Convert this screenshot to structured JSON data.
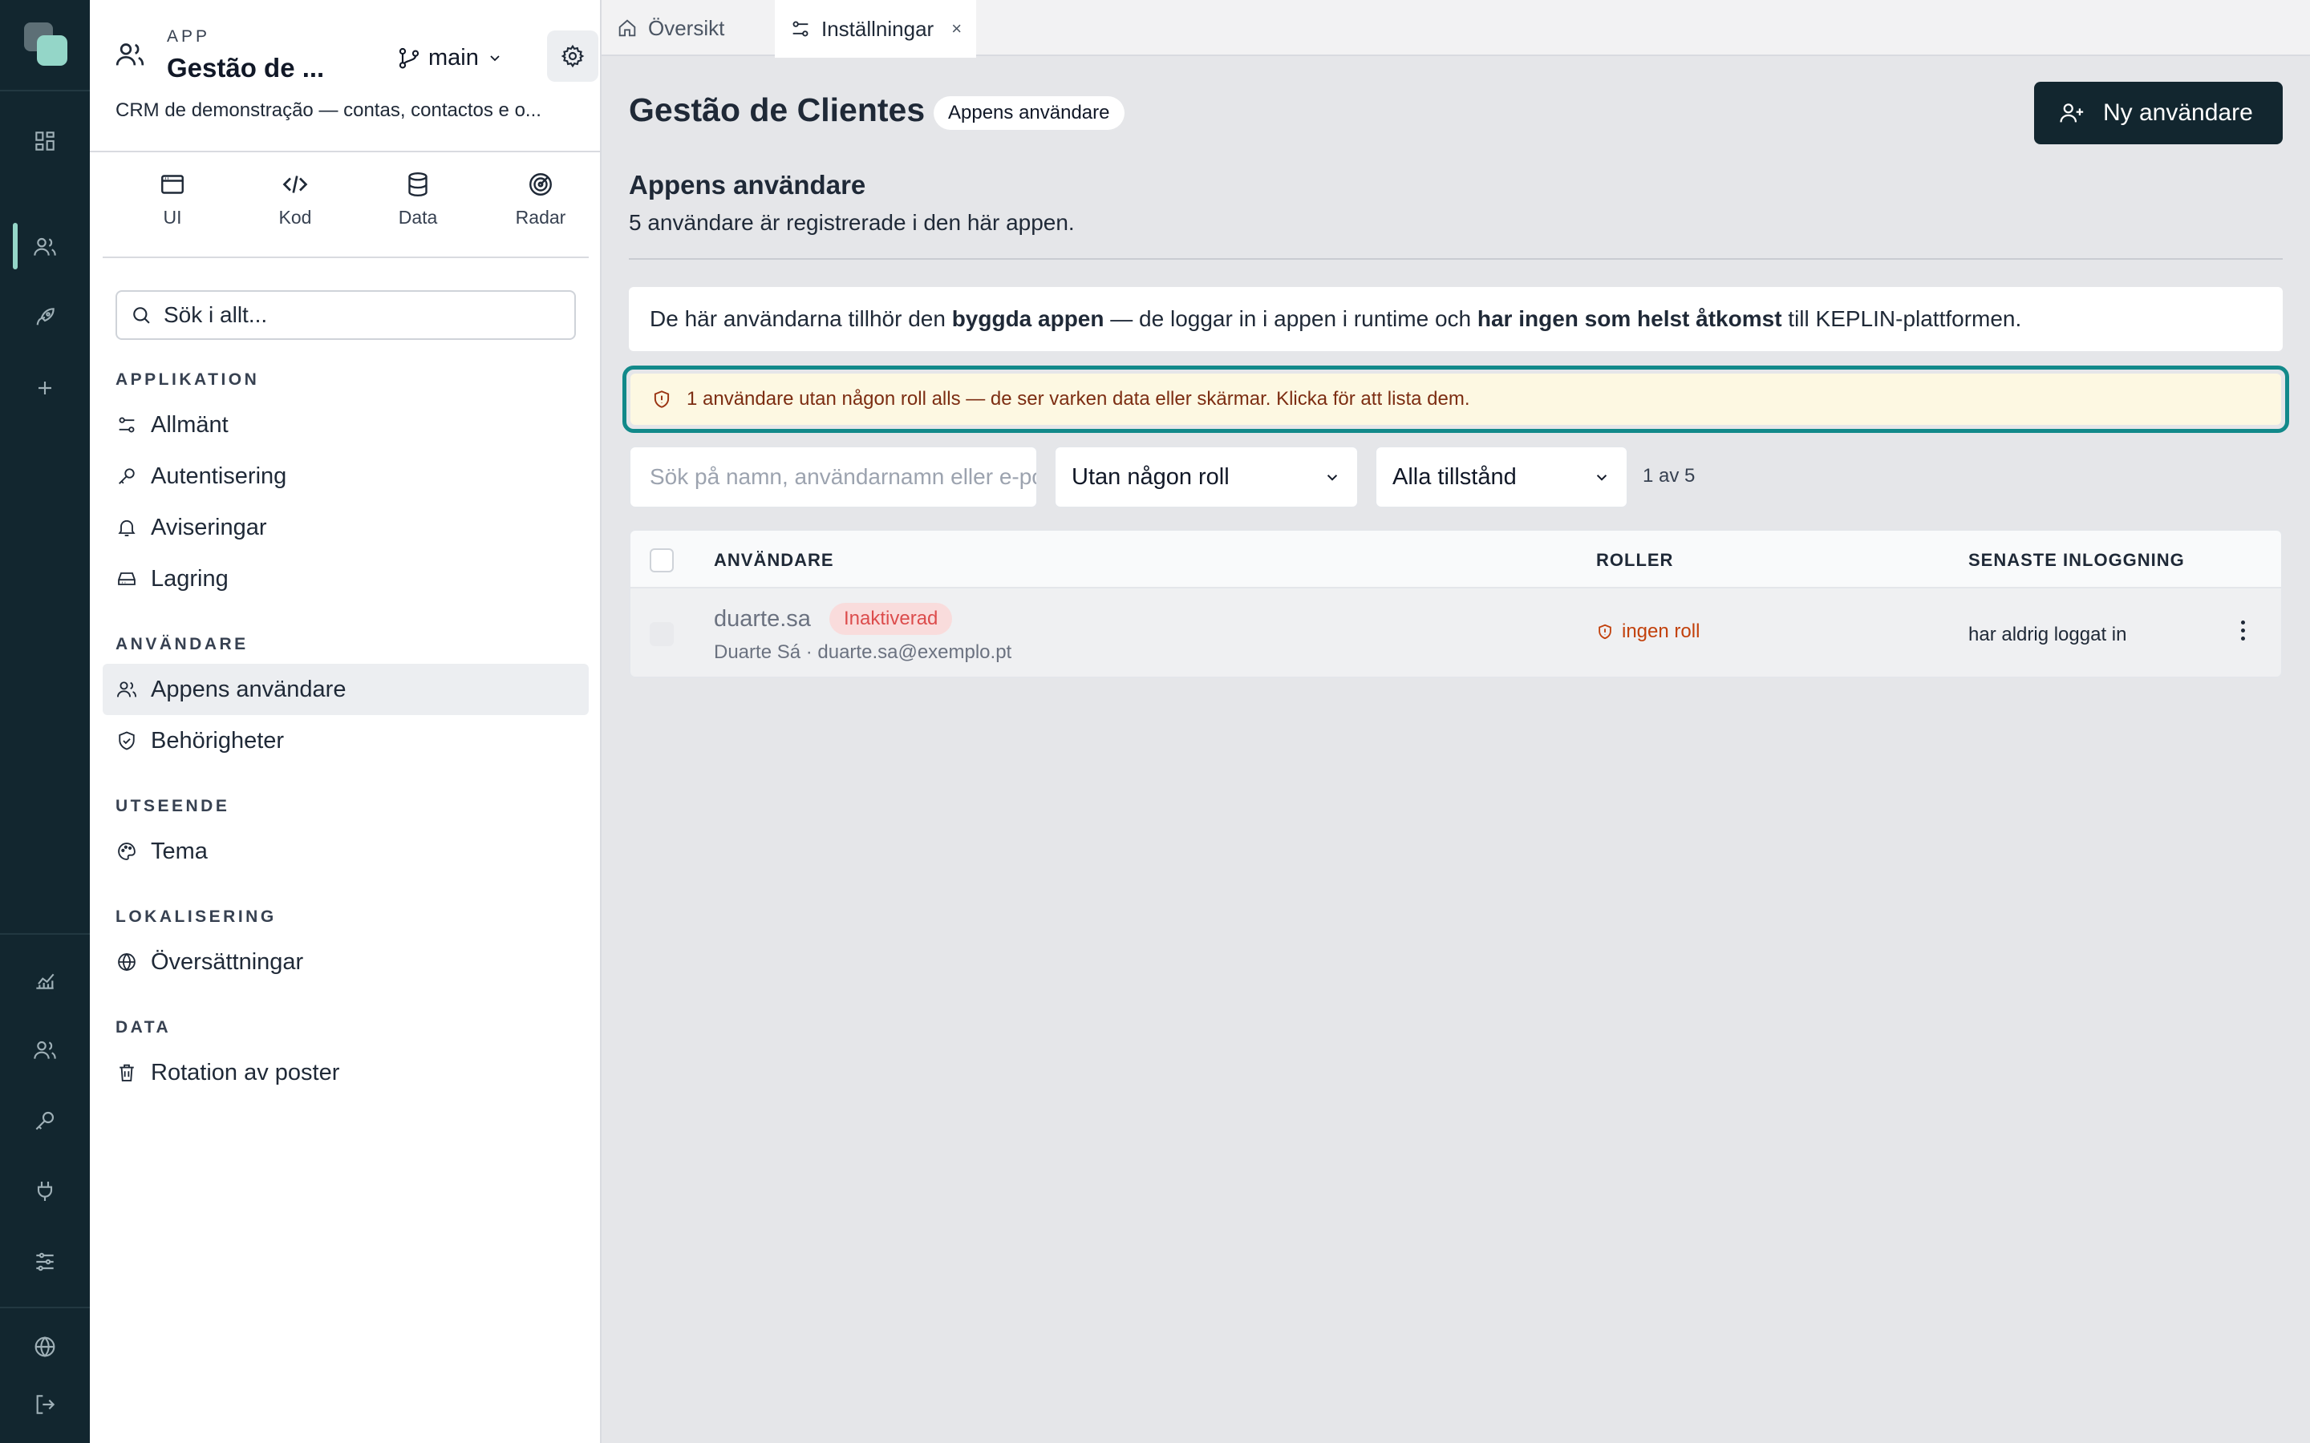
{
  "app": {
    "kicker": "APP",
    "name": "Gestão de ...",
    "branch": "main",
    "description": "CRM de demonstração — contas, contactos e o..."
  },
  "modes": [
    {
      "label": "UI",
      "icon": "browser-window-icon"
    },
    {
      "label": "Kod",
      "icon": "code-icon"
    },
    {
      "label": "Data",
      "icon": "database-icon"
    },
    {
      "label": "Radar",
      "icon": "radar-icon"
    }
  ],
  "search": {
    "placeholder": "Sök i allt..."
  },
  "sidebar": {
    "sections": [
      {
        "title": "APPLIKATION",
        "items": [
          {
            "label": "Allmänt",
            "icon": "sliders-icon"
          },
          {
            "label": "Autentisering",
            "icon": "key-icon"
          },
          {
            "label": "Aviseringar",
            "icon": "bell-icon"
          },
          {
            "label": "Lagring",
            "icon": "hard-drive-icon"
          }
        ]
      },
      {
        "title": "ANVÄNDARE",
        "items": [
          {
            "label": "Appens användare",
            "icon": "users-icon",
            "active": true
          },
          {
            "label": "Behörigheter",
            "icon": "shield-check-icon"
          }
        ]
      },
      {
        "title": "UTSEENDE",
        "items": [
          {
            "label": "Tema",
            "icon": "palette-icon"
          }
        ]
      },
      {
        "title": "LOKALISERING",
        "items": [
          {
            "label": "Översättningar",
            "icon": "globe-icon"
          }
        ]
      },
      {
        "title": "DATA",
        "items": [
          {
            "label": "Rotation av poster",
            "icon": "trash-icon"
          }
        ]
      }
    ]
  },
  "rail": {
    "top_icons": [
      "dashboard-icon",
      "users-icon",
      "rocket-icon",
      "plus-icon"
    ],
    "bottom_icons": [
      "chart-icon",
      "users-icon",
      "key-icon",
      "plug-icon",
      "sliders-icon",
      "globe-icon",
      "logout-icon"
    ]
  },
  "tabs": [
    {
      "label": "Översikt",
      "icon": "home-icon"
    },
    {
      "label": "Inställningar",
      "icon": "sliders-icon",
      "close": "×"
    }
  ],
  "page": {
    "title": "Gestão de Clientes",
    "badge": "Appens användare",
    "new_user_button": "Ny användare",
    "section_title": "Appens användare",
    "section_subtitle": "5 användare är registrerade i den här appen."
  },
  "info": {
    "part1": "De här användarna tillhör den ",
    "bold1": "byggda appen",
    "part2": " — de loggar in i appen i runtime och ",
    "bold2": "har ingen som helst åtkomst",
    "part3": " till KEPLIN-plattformen."
  },
  "warning": {
    "text": "1 användare utan någon roll alls — de ser varken data eller skärmar. Klicka för att lista dem."
  },
  "filters": {
    "search_placeholder": "Sök på namn, användarnamn eller e-post",
    "role_filter": "Utan någon roll",
    "status_filter": "Alla tillstånd",
    "count": "1 av 5"
  },
  "table": {
    "headers": {
      "user": "ANVÄNDARE",
      "roles": "ROLLER",
      "last_login": "SENASTE INLOGGNING"
    },
    "rows": [
      {
        "username": "duarte.sa",
        "status": "Inaktiverad",
        "full_name_email": "Duarte Sá · duarte.sa@exemplo.pt",
        "roles": "ingen roll",
        "last_login": "har aldrig loggat in"
      }
    ]
  },
  "colors": {
    "rail": "#12262f",
    "accent": "#94d6c8",
    "primary_button": "#12262f",
    "warning_bg": "#fdf8e2",
    "warning_text": "#7c2d12",
    "focus_ring": "#12898a",
    "inactive_badge": "#dc4c4c",
    "no_role": "#c2410c"
  }
}
